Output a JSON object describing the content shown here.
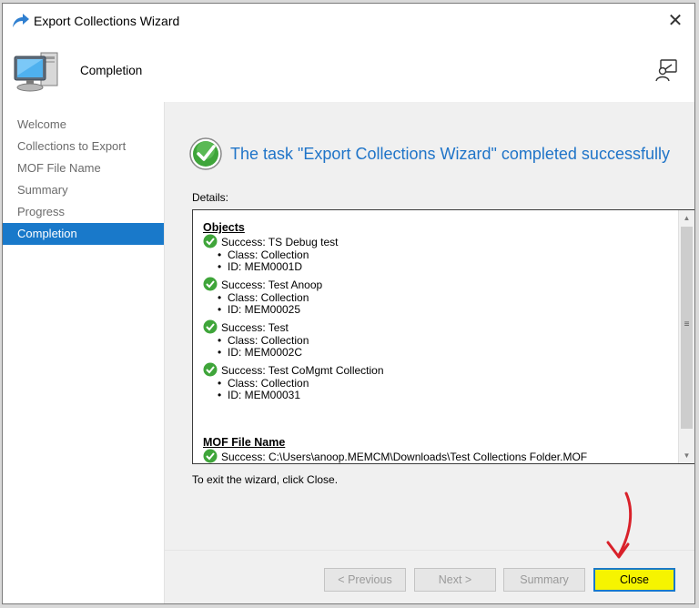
{
  "window": {
    "title": "Export Collections Wizard",
    "close_glyph": "✕"
  },
  "header": {
    "title": "Completion"
  },
  "sidebar": {
    "items": [
      {
        "label": "Welcome"
      },
      {
        "label": "Collections to Export"
      },
      {
        "label": "MOF File Name"
      },
      {
        "label": "Summary"
      },
      {
        "label": "Progress"
      },
      {
        "label": "Completion",
        "active": true
      }
    ]
  },
  "main": {
    "status": "The task \"Export Collections Wizard\" completed successfully",
    "details_label": "Details:",
    "details": {
      "objects_heading": "Objects",
      "objects": [
        {
          "name": "Success: TS Debug test",
          "class": "Class: Collection",
          "id": "ID: MEM0001D"
        },
        {
          "name": "Success: Test Anoop",
          "class": "Class: Collection",
          "id": "ID: MEM00025"
        },
        {
          "name": "Success: Test",
          "class": "Class: Collection",
          "id": "ID: MEM0002C"
        },
        {
          "name": "Success: Test CoMgmt Collection",
          "class": "Class: Collection",
          "id": "ID: MEM00031"
        }
      ],
      "mof_heading": "MOF File Name",
      "mof_line": "Success: C:\\Users\\anoop.MEMCM\\Downloads\\Test Collections Folder.MOF"
    },
    "exit_text": "To exit the wizard, click Close."
  },
  "footer": {
    "previous_label": "< Previous",
    "next_label": "Next >",
    "summary_label": "Summary",
    "close_label": "Close"
  },
  "colors": {
    "accent": "#1979ca",
    "status_text": "#1f74c8",
    "close_highlight": "#f6f400",
    "annotation_arrow": "#d9212a"
  }
}
